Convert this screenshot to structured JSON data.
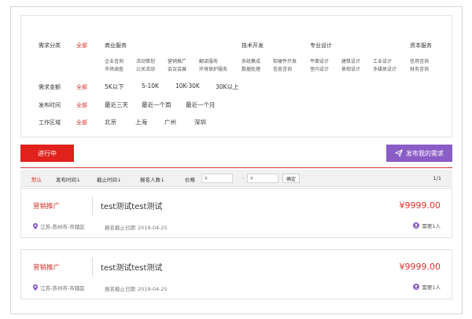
{
  "filters": {
    "category": {
      "label": "需求分类",
      "all": "全部",
      "groups": [
        {
          "title": "商业服务",
          "items": [
            "企业咨询",
            "活动策划",
            "营销推广",
            "翻译服务",
            "市场调查",
            "公关活动",
            "会议会展",
            "环境保护服务"
          ]
        },
        {
          "title": "技术开发",
          "items": [
            "系统集成",
            "软硬件开发",
            "数据处理",
            "信息咨询"
          ]
        },
        {
          "title": "专业设计",
          "items": [
            "平面设计",
            "建筑设计",
            "工业设计",
            "室内设计",
            "景观设计",
            "多媒体设计"
          ]
        },
        {
          "title": "资本服务",
          "items": [
            "信用咨询",
            "财务咨询"
          ]
        }
      ]
    },
    "amount": {
      "label": "需求金额",
      "all": "全部",
      "options": [
        "5K以下",
        "5-10K",
        "10K-30K",
        "30K以上"
      ]
    },
    "time": {
      "label": "发布时间",
      "all": "全部",
      "options": [
        "最近三天",
        "最近一个周",
        "最近一个月"
      ]
    },
    "region": {
      "label": "工作区域",
      "all": "全部",
      "options": [
        "北京",
        "上海",
        "广州",
        "深圳"
      ]
    }
  },
  "tabs": {
    "active": "进行中",
    "publish": "发布我的需求"
  },
  "sortbar": {
    "default": "默认",
    "publish_time": "发布时间",
    "deadline": "截止时间",
    "applicants": "报名人数",
    "price": "价格",
    "price_from_placeholder": "¥",
    "price_to_placeholder": "¥",
    "dash": "-",
    "confirm": "确定",
    "page": "1/1",
    "sort_arrow": "↓"
  },
  "listings": [
    {
      "tag": "营销推广",
      "title": "test测试test测试",
      "price": "¥9999.00",
      "location": "江苏-苏州市-市辖区",
      "deadline_label": "报名截止日期",
      "deadline": "2019-04-25",
      "need": "需要1人"
    },
    {
      "tag": "营销推广",
      "title": "test测试test测试",
      "price": "¥9999.00",
      "location": "江苏-苏州市-市辖区",
      "deadline_label": "报名截止日期",
      "deadline": "2019-04-25",
      "need": "需要1人"
    }
  ],
  "colors": {
    "accent": "#d8322c",
    "publish": "#8a5cc7"
  },
  "icons": {
    "publish": "send-icon",
    "location": "location-pin-icon",
    "user": "user-icon"
  }
}
